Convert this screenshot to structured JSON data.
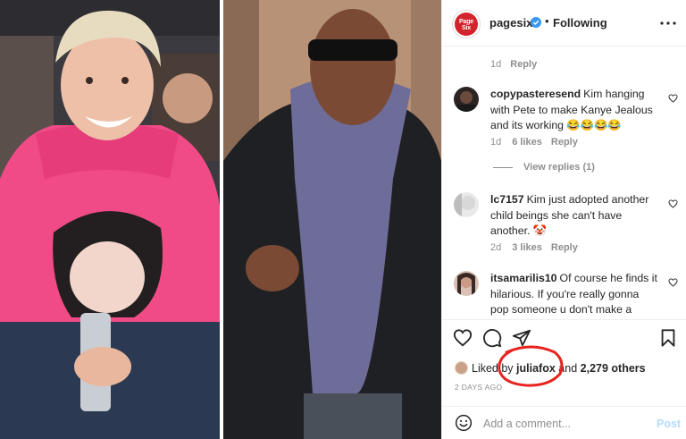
{
  "post": {
    "image_description_icons": [
      "photo-left-person",
      "photo-right-person"
    ],
    "header": {
      "avatar_text_line1": "Page",
      "avatar_text_line2": "Six",
      "username": "pagesix",
      "separator": "•",
      "follow_status": "Following"
    },
    "top_meta": {
      "time": "1d",
      "reply": "Reply"
    },
    "comments": [
      {
        "username": "copypasteresend",
        "text": "Kim hanging with Pete to make Kanye Jealous and its working 😂😂😂😂",
        "time": "1d",
        "likes": "6 likes",
        "reply": "Reply"
      },
      {
        "username": "lc7157",
        "text": "Kim just adopted another child beings she can't have another. 🤡",
        "time": "2d",
        "likes": "3 likes",
        "reply": "Reply"
      },
      {
        "username": "itsamarilis10",
        "text": "Of course he finds it hilarious. If you're really gonna pop someone u don't make a song about it"
      }
    ],
    "view_replies": "View replies (1)",
    "liked_by": {
      "prefix": "Liked by",
      "user": "juliafox",
      "joiner": "and",
      "others": "2,279 others"
    },
    "time_ago": "2 DAYS AGO",
    "add_comment": {
      "placeholder": "Add a comment...",
      "post_label": "Post"
    },
    "colors": {
      "annotation": "#e8231f",
      "verified": "#3897f0",
      "post_button_disabled": "#b3dbff",
      "pagesix_red": "#d3232c"
    }
  }
}
